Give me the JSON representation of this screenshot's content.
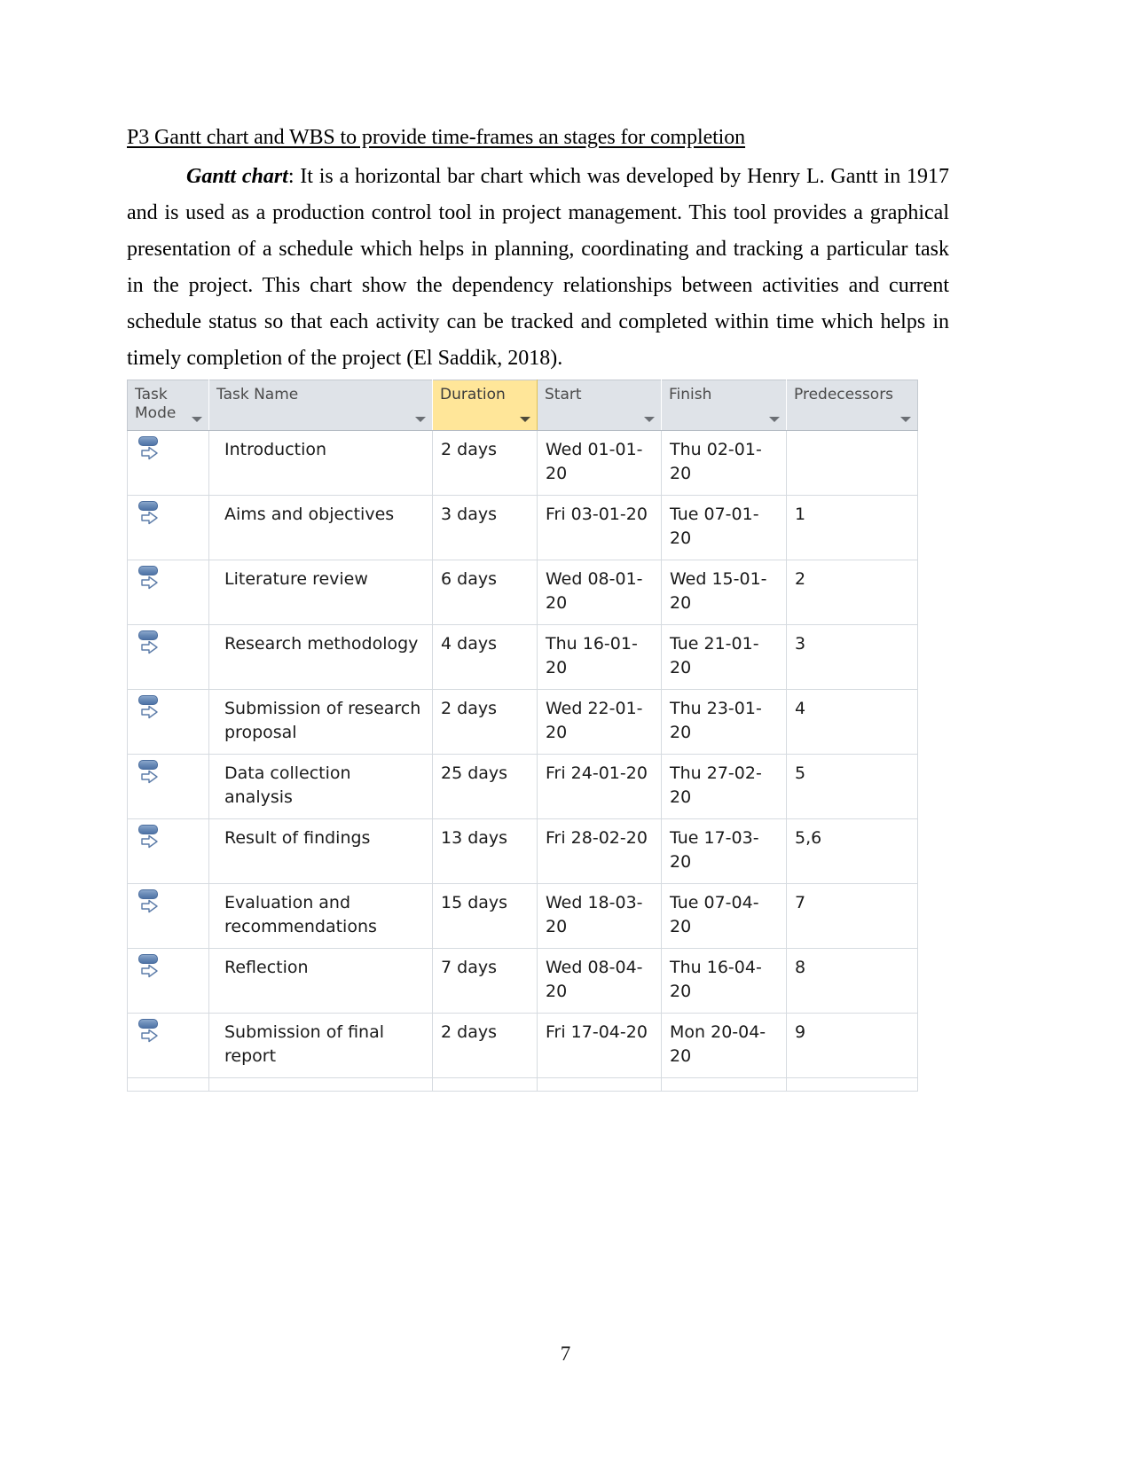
{
  "document": {
    "heading": "P3 Gantt chart and WBS to provide time-frames an stages for completion",
    "paragraph_lead": "Gantt chart",
    "paragraph_text": ": It is a horizontal bar chart which was developed by Henry L. Gantt in 1917 and is used as a production control tool in project management. This tool provides a graphical presentation of a schedule which helps in planning, coordinating and tracking a particular task in the project. This chart show the dependency relationships between activities and current schedule status so that each activity can be tracked and completed within time which helps in timely completion of the project (El Saddik, 2018).",
    "page_number": "7"
  },
  "grid": {
    "highlight_color": "#ffe699",
    "header_color": "#dfe3e8",
    "columns": [
      {
        "key": "task_mode",
        "label": "Task Mode",
        "highlighted": false,
        "has_filter": true
      },
      {
        "key": "task_name",
        "label": "Task Name",
        "highlighted": false,
        "has_filter": true
      },
      {
        "key": "duration",
        "label": "Duration",
        "highlighted": true,
        "has_filter": true
      },
      {
        "key": "start",
        "label": "Start",
        "highlighted": false,
        "has_filter": true
      },
      {
        "key": "finish",
        "label": "Finish",
        "highlighted": false,
        "has_filter": true
      },
      {
        "key": "predecessors",
        "label": "Predecessors",
        "highlighted": false,
        "has_filter": true
      }
    ],
    "mode_icon": "auto-scheduled-icon",
    "rows": [
      {
        "task_name": "Introduction",
        "duration": "2 days",
        "start": "Wed 01-01-20",
        "finish": "Thu 02-01-20",
        "predecessors": ""
      },
      {
        "task_name": "Aims and objectives",
        "duration": "3 days",
        "start": "Fri 03-01-20",
        "finish": "Tue 07-01-20",
        "predecessors": "1"
      },
      {
        "task_name": "Literature review",
        "duration": "6 days",
        "start": "Wed 08-01-20",
        "finish": "Wed 15-01-20",
        "predecessors": "2"
      },
      {
        "task_name": "Research methodology",
        "duration": "4 days",
        "start": "Thu 16-01-20",
        "finish": "Tue 21-01-20",
        "predecessors": "3"
      },
      {
        "task_name": "Submission of research proposal",
        "duration": "2 days",
        "start": "Wed 22-01-20",
        "finish": "Thu 23-01-20",
        "predecessors": "4"
      },
      {
        "task_name": "Data collection analysis",
        "duration": "25 days",
        "start": "Fri 24-01-20",
        "finish": "Thu 27-02-20",
        "predecessors": "5"
      },
      {
        "task_name": "Result of findings",
        "duration": "13 days",
        "start": "Fri 28-02-20",
        "finish": "Tue 17-03-20",
        "predecessors": "5,6"
      },
      {
        "task_name": "Evaluation and recommendations",
        "duration": "15 days",
        "start": "Wed 18-03-20",
        "finish": "Tue 07-04-20",
        "predecessors": "7"
      },
      {
        "task_name": "Reflection",
        "duration": "7 days",
        "start": "Wed 08-04-20",
        "finish": "Thu 16-04-20",
        "predecessors": "8"
      },
      {
        "task_name": "Submission of final report",
        "duration": "2 days",
        "start": "Fri 17-04-20",
        "finish": "Mon 20-04-20",
        "predecessors": "9"
      }
    ]
  }
}
